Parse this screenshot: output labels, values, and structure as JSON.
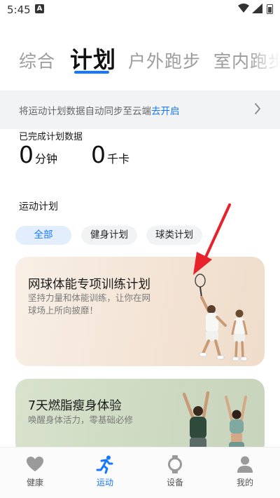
{
  "status_bar": {
    "time": "5:45",
    "notif_glyph": "A"
  },
  "tabs": [
    {
      "label": "综合"
    },
    {
      "label": "计划"
    },
    {
      "label": "户外跑步"
    },
    {
      "label": "室内跑步"
    }
  ],
  "sync_banner": {
    "text": "将运动计划数据自动同步至云端",
    "link": "去开启"
  },
  "completed": {
    "title": "已完成计划数据",
    "minutes": {
      "value": "0",
      "unit": "分钟"
    },
    "calories": {
      "value": "0",
      "unit": "千卡"
    }
  },
  "plans": {
    "title": "运动计划",
    "filters": [
      "全部",
      "健身计划",
      "球类计划"
    ]
  },
  "cards": [
    {
      "title": "网球体能专项训练计划",
      "desc": "坚持力量和体能训练，让你在网球场上所向披靡！"
    },
    {
      "title": "7天燃脂瘦身体验",
      "desc": "唤醒身体活力，零基础必修"
    }
  ],
  "bottom_nav": [
    {
      "label": "健康",
      "icon": "heart-icon"
    },
    {
      "label": "运动",
      "icon": "running-icon"
    },
    {
      "label": "设备",
      "icon": "watch-icon"
    },
    {
      "label": "我的",
      "icon": "person-icon"
    }
  ],
  "colors": {
    "accent": "#1677ff",
    "annotation_arrow": "#e8222b"
  }
}
